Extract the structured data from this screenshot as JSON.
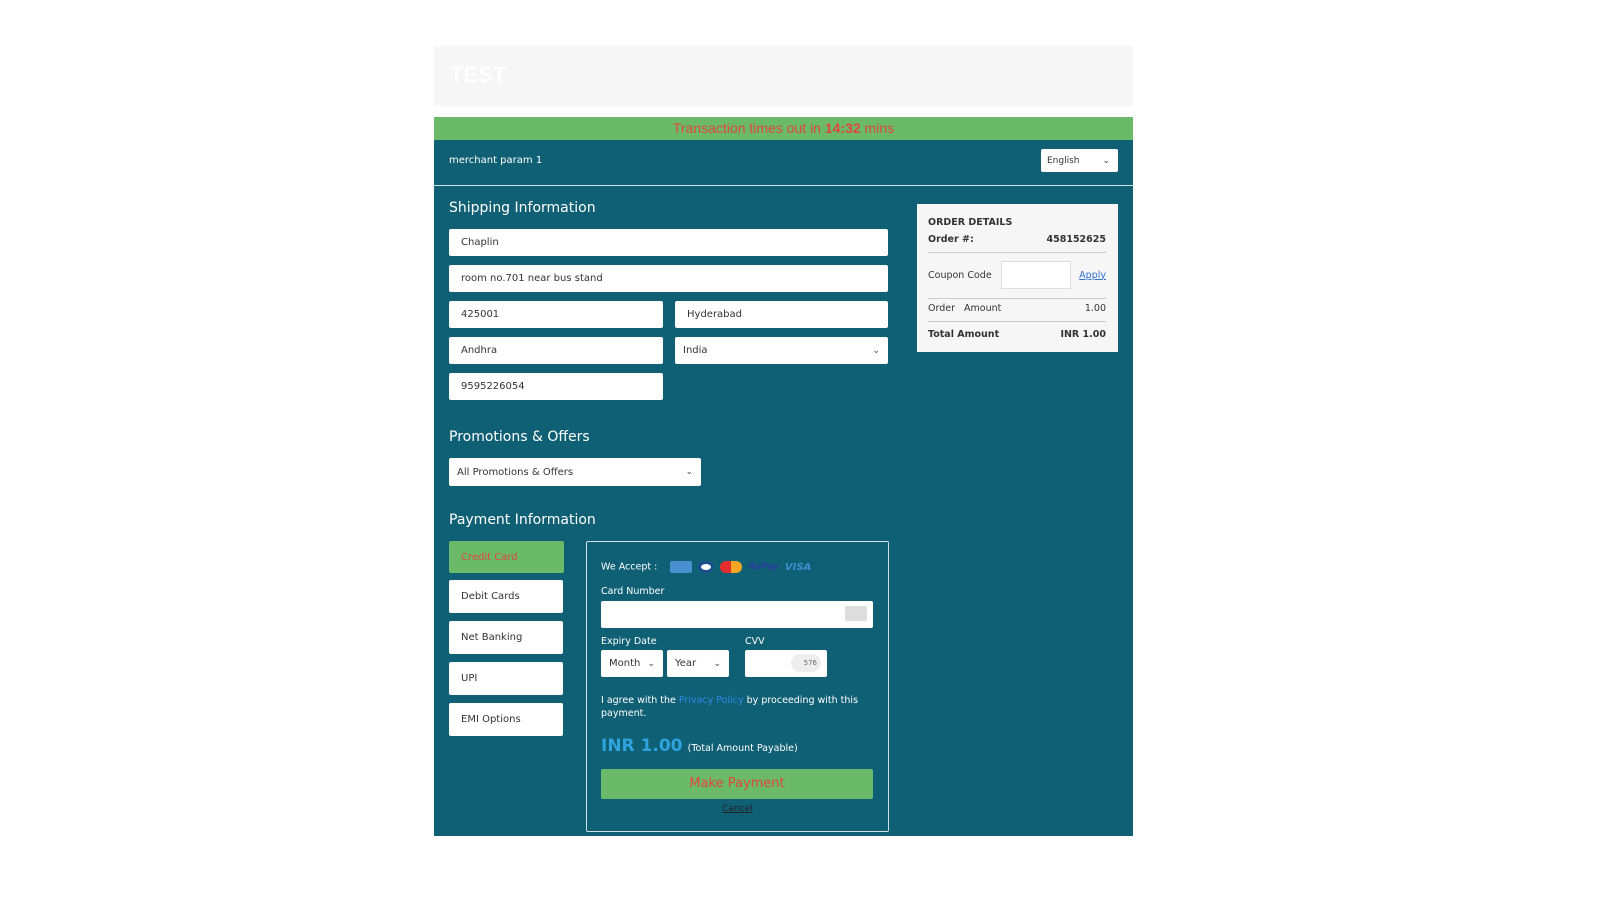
{
  "header": {
    "brand": "TEST"
  },
  "timer": {
    "prefix": "Transaction times out in ",
    "time": "14:32",
    "suffix": " mins"
  },
  "topbar": {
    "merchant": "merchant param 1",
    "language": "English"
  },
  "shipping": {
    "title": "Shipping Information",
    "name": "Chaplin",
    "address": "room no.701 near bus stand",
    "zip": "425001",
    "city": "Hyderabad",
    "state": "Andhra",
    "country": "India",
    "phone": "9595226054"
  },
  "promotions": {
    "title": "Promotions & Offers",
    "selected": "All Promotions & Offers"
  },
  "payment": {
    "title": "Payment Information",
    "tabs": [
      "Credit Card",
      "Debit Cards",
      "Net Banking",
      "UPI",
      "EMI Options"
    ],
    "active_tab": "Credit Card"
  },
  "card_form": {
    "we_accept": "We Accept :",
    "card_logos": [
      "amex",
      "diners-club",
      "mastercard",
      "rupay",
      "visa"
    ],
    "card_number_label": "Card Number",
    "expiry_label": "Expiry Date",
    "month": "Month",
    "year": "Year",
    "cvv_label": "CVV",
    "cvv_hint": "576",
    "agree_prefix": "I agree with the ",
    "privacy_link": "Privacy Policy",
    "agree_suffix": " by proceeding with this payment.",
    "amount": "INR 1.00",
    "amount_note": "(Total Amount Payable)",
    "submit": "Make Payment",
    "cancel": "Cancel"
  },
  "order": {
    "title": "ORDER DETAILS",
    "order_label": "Order  #:",
    "order_no": "458152625",
    "coupon_label": "Coupon Code",
    "coupon_value": "",
    "apply": "Apply",
    "amount_label": "Order   Amount",
    "amount": "1.00",
    "total_label": "Total Amount",
    "total": "INR 1.00"
  },
  "colors": {
    "panel": "#0f6074",
    "accent_green": "#6aba6a",
    "alert_red": "#e0473a",
    "amount_blue": "#2ea3dd"
  }
}
